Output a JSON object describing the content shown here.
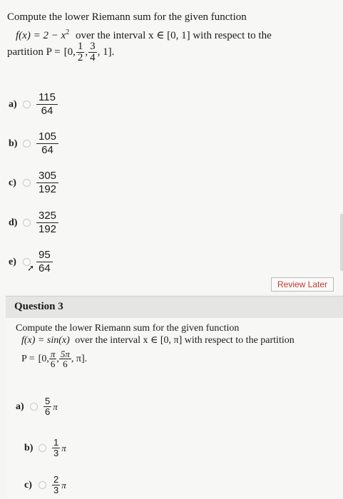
{
  "question2": {
    "line1": "Compute the lower Riemann sum for the given function",
    "fx": "f(x) = 2 − x",
    "exp": "2",
    "over": "over the interval x ∈ [0, 1] with respect to the",
    "partition_prefix": "partition P =",
    "partition_open": "[0,",
    "p1_num": "1",
    "p1_den": "2",
    "p2_num": "3",
    "p2_den": "4",
    "partition_close": ", 1]",
    "options": [
      {
        "label": "a)",
        "num": "115",
        "den": "64"
      },
      {
        "label": "b)",
        "num": "105",
        "den": "64"
      },
      {
        "label": "c)",
        "num": "305",
        "den": "192"
      },
      {
        "label": "d)",
        "num": "325",
        "den": "192"
      },
      {
        "label": "e)",
        "num": "95",
        "den": "64"
      }
    ],
    "review_later": "Review Later"
  },
  "question3": {
    "title": "Question 3",
    "line1": "Compute the lower Riemann sum for the given function",
    "fx": "f(x) = sin(x)",
    "over": "over the interval x ∈ [0, π] with respect to the partition",
    "partition_prefix": "P =",
    "partition_open": "[0,",
    "p1_num": "π",
    "p1_den": "6",
    "p2_num": "5π",
    "p2_den": "6",
    "partition_close": ", π]",
    "options": [
      {
        "label": "a)",
        "num": "5",
        "den": "6",
        "suffix": "π"
      },
      {
        "label": "b)",
        "num": "1",
        "den": "3",
        "suffix": "π"
      },
      {
        "label": "c)",
        "num": "2",
        "den": "3",
        "suffix": "π"
      }
    ]
  }
}
